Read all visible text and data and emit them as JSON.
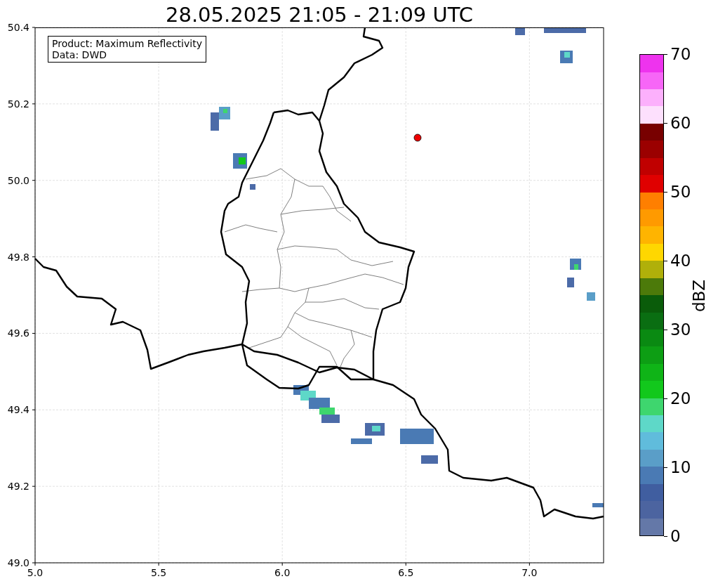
{
  "figure": {
    "title": "28.05.2025 21:05 - 21:09 UTC"
  },
  "map": {
    "annotation": [
      "Product: Maximum Reflectivity",
      "Data: DWD"
    ],
    "xticks": [
      "5.0",
      "5.5",
      "6.0",
      "6.5",
      "7.0"
    ],
    "yticks": [
      "50.4",
      "50.2",
      "50.0",
      "49.8",
      "49.6",
      "49.4",
      "49.2",
      "49.0"
    ]
  },
  "colorbar": {
    "label": "dBZ",
    "ticks": [
      "70",
      "60",
      "50",
      "40",
      "30",
      "20",
      "10",
      "0"
    ],
    "bins": [
      {
        "color": "#6478a8"
      },
      {
        "color": "#4c64a0"
      },
      {
        "color": "#405ea0"
      },
      {
        "color": "#4a7ab4"
      },
      {
        "color": "#5a9ec8"
      },
      {
        "color": "#60bcdc"
      },
      {
        "color": "#5ed8c8"
      },
      {
        "color": "#3ed66e"
      },
      {
        "color": "#12c81c"
      },
      {
        "color": "#0fb417"
      },
      {
        "color": "#0d9e14"
      },
      {
        "color": "#0a8a12"
      },
      {
        "color": "#0a6e12"
      },
      {
        "color": "#0a5c0a"
      },
      {
        "color": "#4c7a0a"
      },
      {
        "color": "#b0b00a"
      },
      {
        "color": "#ffd700"
      },
      {
        "color": "#ffb400"
      },
      {
        "color": "#ff9a00"
      },
      {
        "color": "#ff7f00"
      },
      {
        "color": "#e00000"
      },
      {
        "color": "#c00000"
      },
      {
        "color": "#9b0000"
      },
      {
        "color": "#780000"
      },
      {
        "color": "#fde0fd"
      },
      {
        "color": "#fcb0fc"
      },
      {
        "color": "#f766f7"
      },
      {
        "color": "#ee33ee"
      }
    ]
  }
}
